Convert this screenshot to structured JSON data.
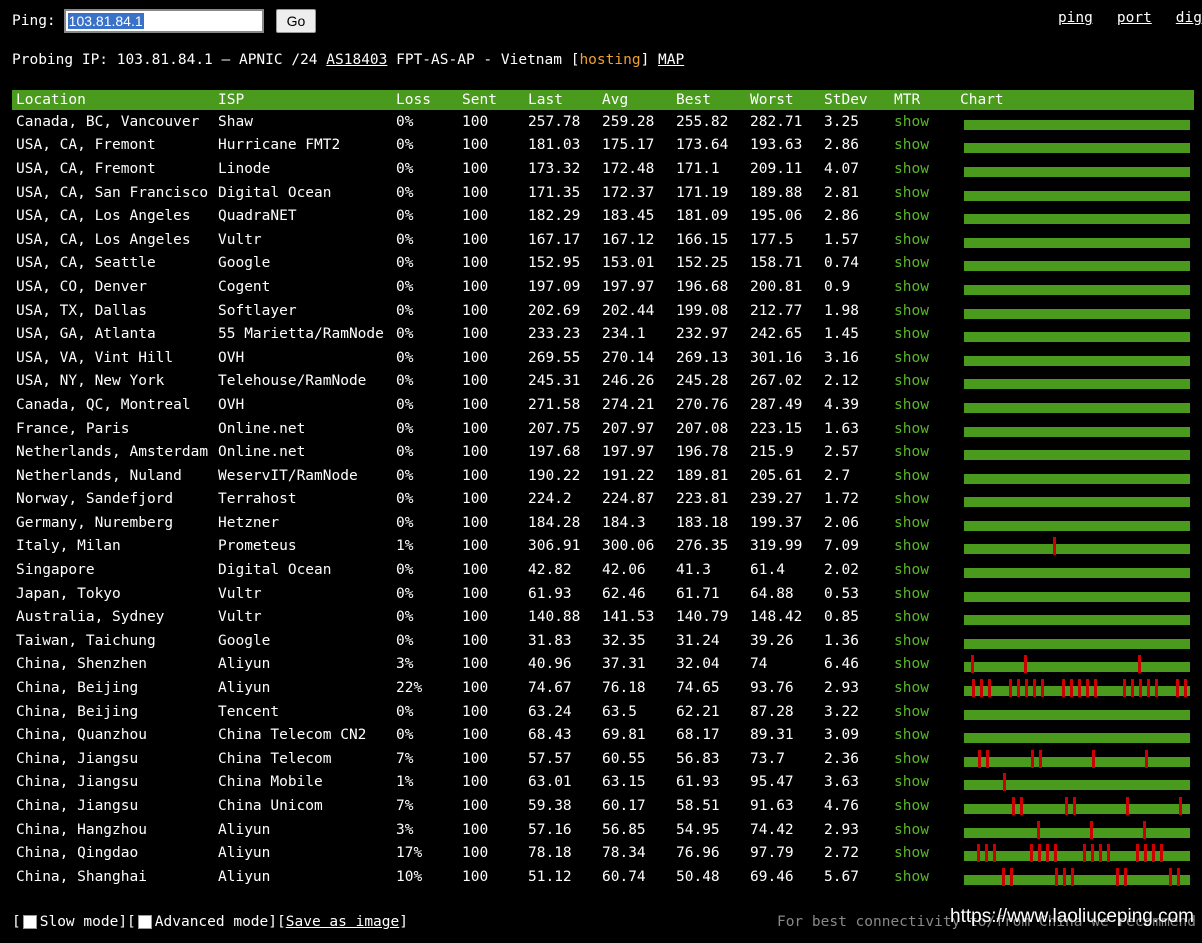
{
  "topbar": {
    "ping_label": "Ping:",
    "ip_value": "103.81.84.1",
    "go_label": "Go",
    "links": [
      "ping",
      "port",
      "dig"
    ]
  },
  "probing": {
    "prefix": "Probing IP: 103.81.84.1 – APNIC /24 ",
    "asn": "AS18403",
    "mid": " FPT-AS-AP - Vietnam [",
    "hosting": "hosting",
    "close": "] ",
    "map": "MAP"
  },
  "table": {
    "headers": [
      "Location",
      "ISP",
      "Loss",
      "Sent",
      "Last",
      "Avg",
      "Best",
      "Worst",
      "StDev",
      "MTR",
      "Chart"
    ],
    "mtr_label": "show",
    "colors": {
      "header_bg": "#4a9a1e",
      "bar": "#4a9a1e",
      "loss": "#cc0000",
      "show": "#5ab82a"
    },
    "rows": [
      [
        "Canada, BC, Vancouver",
        "Shaw",
        "0%",
        "100",
        "257.78",
        "259.28",
        "255.82",
        "282.71",
        "3.25"
      ],
      [
        "USA, CA, Fremont",
        "Hurricane FMT2",
        "0%",
        "100",
        "181.03",
        "175.17",
        "173.64",
        "193.63",
        "2.86"
      ],
      [
        "USA, CA, Fremont",
        "Linode",
        "0%",
        "100",
        "173.32",
        "172.48",
        "171.1",
        "209.11",
        "4.07"
      ],
      [
        "USA, CA, San Francisco",
        "Digital Ocean",
        "0%",
        "100",
        "171.35",
        "172.37",
        "171.19",
        "189.88",
        "2.81"
      ],
      [
        "USA, CA, Los Angeles",
        "QuadraNET",
        "0%",
        "100",
        "182.29",
        "183.45",
        "181.09",
        "195.06",
        "2.86"
      ],
      [
        "USA, CA, Los Angeles",
        "Vultr",
        "0%",
        "100",
        "167.17",
        "167.12",
        "166.15",
        "177.5",
        "1.57"
      ],
      [
        "USA, CA, Seattle",
        "Google",
        "0%",
        "100",
        "152.95",
        "153.01",
        "152.25",
        "158.71",
        "0.74"
      ],
      [
        "USA, CO, Denver",
        "Cogent",
        "0%",
        "100",
        "197.09",
        "197.97",
        "196.68",
        "200.81",
        "0.9"
      ],
      [
        "USA, TX, Dallas",
        "Softlayer",
        "0%",
        "100",
        "202.69",
        "202.44",
        "199.08",
        "212.77",
        "1.98"
      ],
      [
        "USA, GA, Atlanta",
        "55 Marietta/RamNode",
        "0%",
        "100",
        "233.23",
        "234.1",
        "232.97",
        "242.65",
        "1.45"
      ],
      [
        "USA, VA, Vint Hill",
        "OVH",
        "0%",
        "100",
        "269.55",
        "270.14",
        "269.13",
        "301.16",
        "3.16"
      ],
      [
        "USA, NY, New York",
        "Telehouse/RamNode",
        "0%",
        "100",
        "245.31",
        "246.26",
        "245.28",
        "267.02",
        "2.12"
      ],
      [
        "Canada, QC, Montreal",
        "OVH",
        "0%",
        "100",
        "271.58",
        "274.21",
        "270.76",
        "287.49",
        "4.39"
      ],
      [
        "France, Paris",
        "Online.net",
        "0%",
        "100",
        "207.75",
        "207.97",
        "207.08",
        "223.15",
        "1.63"
      ],
      [
        "Netherlands, Amsterdam",
        "Online.net",
        "0%",
        "100",
        "197.68",
        "197.97",
        "196.78",
        "215.9",
        "2.57"
      ],
      [
        "Netherlands, Nuland",
        "WeservIT/RamNode",
        "0%",
        "100",
        "190.22",
        "191.22",
        "189.81",
        "205.61",
        "2.7"
      ],
      [
        "Norway, Sandefjord",
        "Terrahost",
        "0%",
        "100",
        "224.2",
        "224.87",
        "223.81",
        "239.27",
        "1.72"
      ],
      [
        "Germany, Nuremberg",
        "Hetzner",
        "0%",
        "100",
        "184.28",
        "184.3",
        "183.18",
        "199.37",
        "2.06"
      ],
      [
        "Italy, Milan",
        "Prometeus",
        "1%",
        "100",
        "306.91",
        "300.06",
        "276.35",
        "319.99",
        "7.09"
      ],
      [
        "Singapore",
        "Digital Ocean",
        "0%",
        "100",
        "42.82",
        "42.06",
        "41.3",
        "61.4",
        "2.02"
      ],
      [
        "Japan, Tokyo",
        "Vultr",
        "0%",
        "100",
        "61.93",
        "62.46",
        "61.71",
        "64.88",
        "0.53"
      ],
      [
        "Australia, Sydney",
        "Vultr",
        "0%",
        "100",
        "140.88",
        "141.53",
        "140.79",
        "148.42",
        "0.85"
      ],
      [
        "Taiwan, Taichung",
        "Google",
        "0%",
        "100",
        "31.83",
        "32.35",
        "31.24",
        "39.26",
        "1.36"
      ],
      [
        "China, Shenzhen",
        "Aliyun",
        "3%",
        "100",
        "40.96",
        "37.31",
        "32.04",
        "74",
        "6.46"
      ],
      [
        "China, Beijing",
        "Aliyun",
        "22%",
        "100",
        "74.67",
        "76.18",
        "74.65",
        "93.76",
        "2.93"
      ],
      [
        "China, Beijing",
        "Tencent",
        "0%",
        "100",
        "63.24",
        "63.5",
        "62.21",
        "87.28",
        "3.22"
      ],
      [
        "China, Quanzhou",
        "China Telecom CN2",
        "0%",
        "100",
        "68.43",
        "69.81",
        "68.17",
        "89.31",
        "3.09"
      ],
      [
        "China, Jiangsu",
        "China Telecom",
        "7%",
        "100",
        "57.57",
        "60.55",
        "56.83",
        "73.7",
        "2.36"
      ],
      [
        "China, Jiangsu",
        "China Mobile",
        "1%",
        "100",
        "63.01",
        "63.15",
        "61.93",
        "95.47",
        "3.63"
      ],
      [
        "China, Jiangsu",
        "China Unicom",
        "7%",
        "100",
        "59.38",
        "60.17",
        "58.51",
        "91.63",
        "4.76"
      ],
      [
        "China, Hangzhou",
        "Aliyun",
        "3%",
        "100",
        "57.16",
        "56.85",
        "54.95",
        "74.42",
        "2.93"
      ],
      [
        "China, Qingdao",
        "Aliyun",
        "17%",
        "100",
        "78.18",
        "78.34",
        "76.96",
        "97.79",
        "2.72"
      ],
      [
        "China, Shanghai",
        "Aliyun",
        "10%",
        "100",
        "51.12",
        "60.74",
        "50.48",
        "69.46",
        "5.67"
      ]
    ]
  },
  "footer": {
    "open1": "[",
    "slow": "Slow mode",
    "mid": "][",
    "advanced": "Advanced mode",
    "mid2": "][",
    "save": "Save as image",
    "close": "]",
    "right": "For best connectivity to/from China we recommend "
  },
  "watermark": "https://www.laoliuceping.com"
}
